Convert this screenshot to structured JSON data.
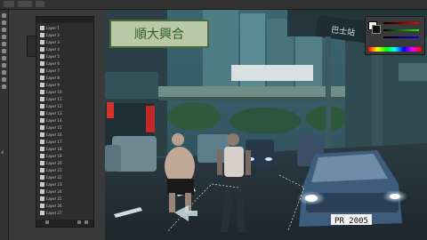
{
  "layers_panel": {
    "title": "Layers",
    "layers": [
      {
        "name": "Layer 1"
      },
      {
        "name": "Layer 2"
      },
      {
        "name": "Layer 3"
      },
      {
        "name": "Layer 4"
      },
      {
        "name": "Layer 5"
      },
      {
        "name": "Layer 6"
      },
      {
        "name": "Layer 7"
      },
      {
        "name": "Layer 8"
      },
      {
        "name": "Layer 9"
      },
      {
        "name": "Layer 10"
      },
      {
        "name": "Layer 11"
      },
      {
        "name": "Layer 12"
      },
      {
        "name": "Layer 13"
      },
      {
        "name": "Layer 14"
      },
      {
        "name": "Layer 15"
      },
      {
        "name": "Layer 16"
      },
      {
        "name": "Layer 17"
      },
      {
        "name": "Layer 18"
      },
      {
        "name": "Layer 19"
      },
      {
        "name": "Layer 20"
      },
      {
        "name": "Layer 21"
      },
      {
        "name": "Layer 22"
      },
      {
        "name": "Layer 23"
      },
      {
        "name": "Layer 24"
      },
      {
        "name": "Layer 25"
      },
      {
        "name": "Layer 26"
      },
      {
        "name": "Layer 27"
      }
    ]
  },
  "canvas": {
    "shop_sign": "順大興合",
    "bus_stop_sign": "巴士站",
    "license_plate": "PR 2005"
  },
  "colors": {
    "app_bg": "#282828",
    "panel_bg": "#2d2d2d",
    "scene_tint": "#2a4a58",
    "headlight": "#e8f4ff",
    "car_blue": "#3a5a7a"
  },
  "icons": {
    "collapse_panel": "chevron-left-icon",
    "tools": "tool-icons"
  }
}
